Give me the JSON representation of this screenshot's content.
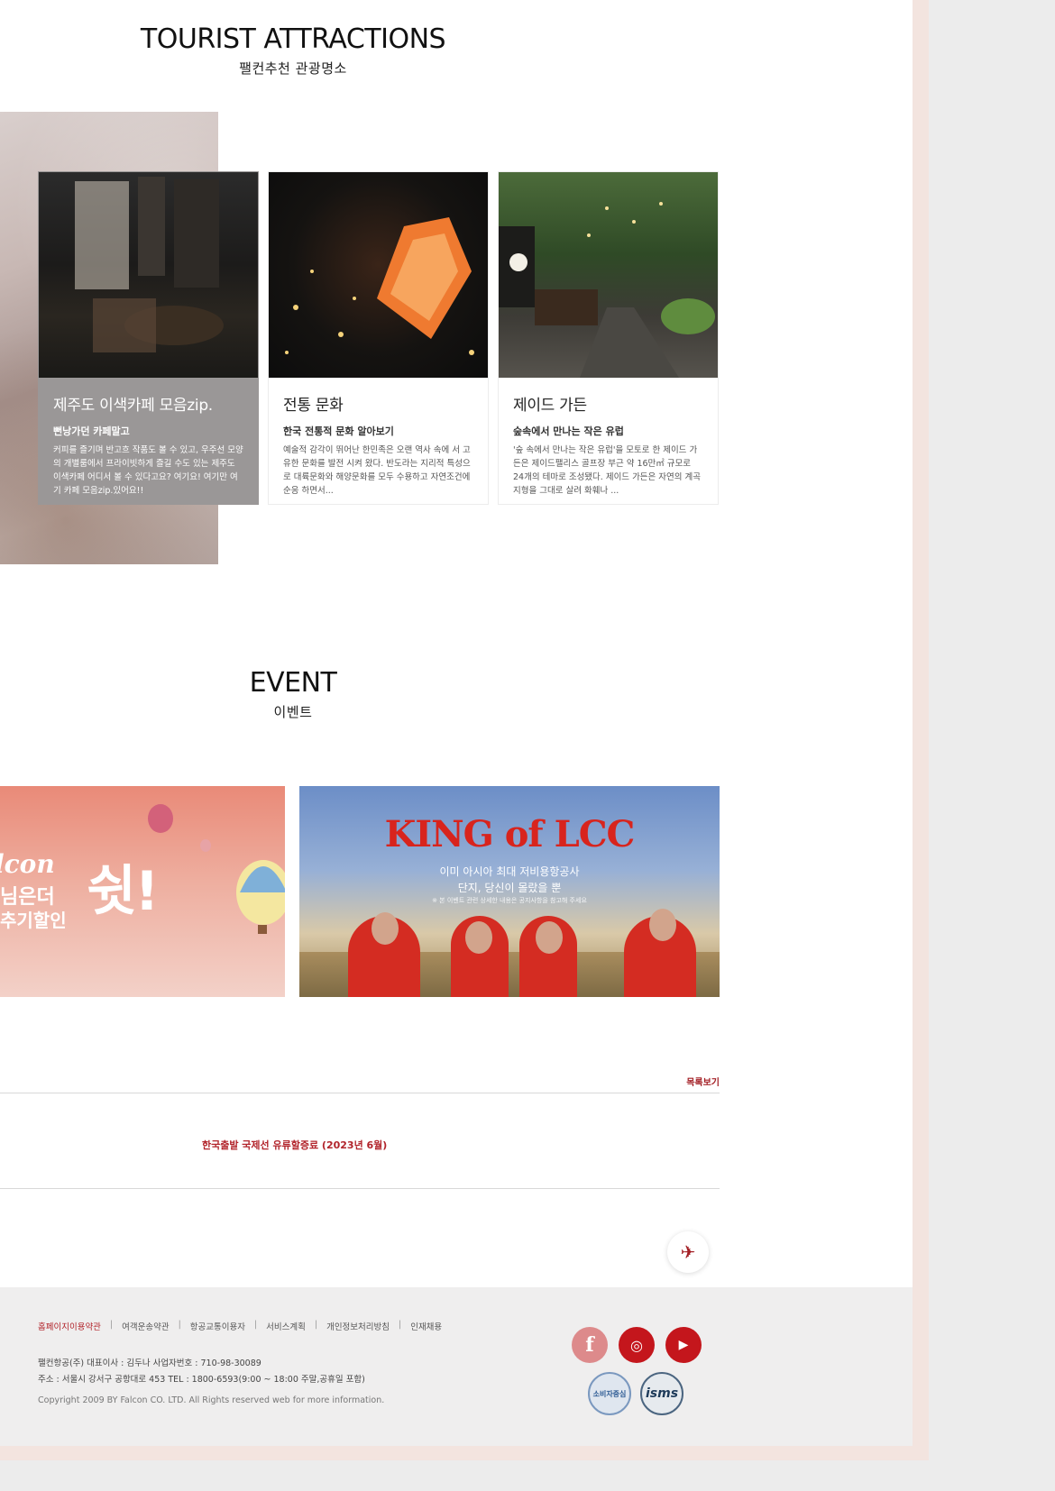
{
  "attractions": {
    "title_en": "TOURIST ATTRACTIONS",
    "title_ko": "팰컨추천 관광명소",
    "cards": [
      {
        "title": "제주도 이색카페 모음zip.",
        "subtitle": "뻔낭가던 카페말고",
        "desc": "커피를 즐기며 반고흐 작품도 볼 수 있고, 우주선 모양의 개별룸에서 프라이빗하게 즐길 수도 있는 제주도 이색카페 어디서 볼 수 있다고요? 여기요! 여기만 여기 카페 모음zip.있어요!!"
      },
      {
        "title": "전통 문화",
        "subtitle": "한국 전통적 문화 알아보기",
        "desc": "예술적 감각이 뛰어난 한민족은 오랜 역사 속에 서 고유한 문화를 발전 시켜 왔다. 반도라는 지리적 특성으로 대륙문화와 해양문화를 모두 수용하고 자연조건에 순응 하면서..."
      },
      {
        "title": "제이드 가든",
        "subtitle": "숲속에서 만나는 작은 유럽",
        "desc": "'숲 속에서 만나는 작은 유럽'을 모토로 한 제이드 가든은 제이드팰리스 골프장 부근 약 16만㎡ 규모로 24개의 테마로 조성됐다. 제이드 가든은 자연의 계곡 지형을 그대로 살려 화훼나 ..."
      }
    ]
  },
  "event": {
    "title_en": "EVENT",
    "title_ko": "이벤트",
    "banner1": {
      "line1": "lcon",
      "line2": "님은더",
      "line3": "추기할인",
      "big": "쉿!"
    },
    "banner2": {
      "title": "KING of LCC",
      "line1": "이미 아시아 최대 저비용항공사",
      "line2": "단지, 당신이 몰랐을 뿐",
      "line3": "※ 본 이벤트 관련 상세한 내용은 공지사항을 참고해 주세요"
    }
  },
  "list_link": "목록보기",
  "notice": "한국출발 국제선 유류할증료 (2023년 6월)",
  "top_button_icon": "airplane-icon",
  "footer": {
    "links": [
      "홈페이지이용약관",
      "여객운송약관",
      "항공교통이용자",
      "서비스계획",
      "개인정보처리방침",
      "인재채용"
    ],
    "info1": "팰컨항공(주) 대표이사 : 김두나 사업자번호 : 710-98-30089",
    "info2": "주소 : 서울시 강서구 공항대로 453 TEL : 1800-6593(9:00 ~ 18:00 주말,공휴일 포함)",
    "copyright": "Copyright 2009 BY Falcon CO. LTD. All Rights reserved web for more information.",
    "sns": {
      "facebook": "f",
      "instagram": "◎",
      "youtube": "▶"
    },
    "badge_consumer": "소비자중심",
    "badge_isms": "isms"
  },
  "colors": {
    "brand_red": "#b2242b",
    "footer_bg": "#efeeee"
  }
}
